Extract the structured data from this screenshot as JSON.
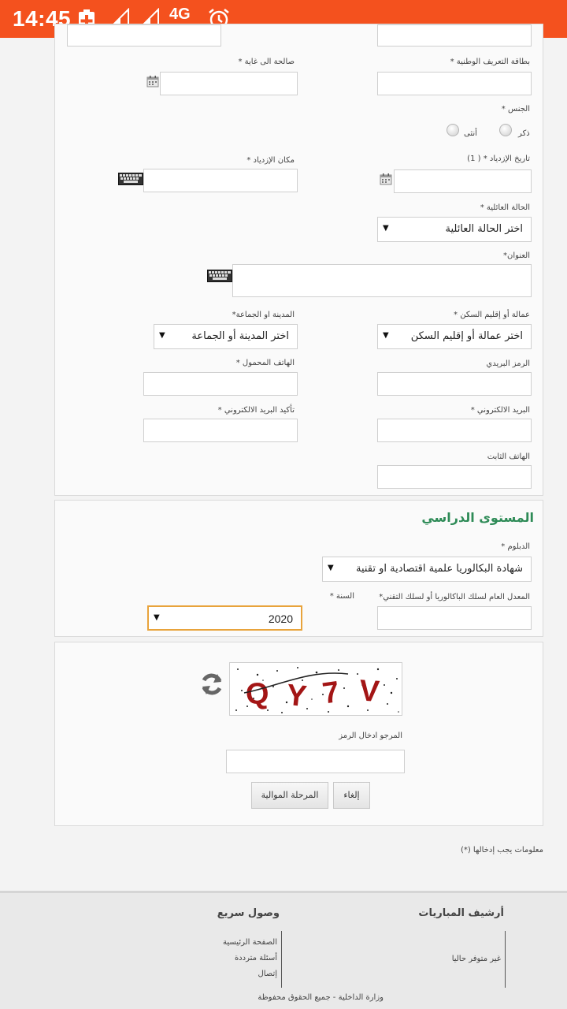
{
  "status_bar": {
    "time": "14:45",
    "network": "4G"
  },
  "personal": {
    "expiry_label": "صالحة الى غاية *",
    "cin_label": "بطاقة التعريف الوطنية *",
    "gender_label": "الجنس *",
    "gender_male": "ذكر",
    "gender_female": "أنثى",
    "birth_date_label": "تاريخ الإزدياد * ( 1)",
    "birth_place_label": "مكان الإزدياد *",
    "marital_label": "الحالة العائلية *",
    "marital_value": "اختر الحالة العائلية",
    "address_label": "العنوان*",
    "prefecture_label": "عمالة أو إقليم السكن *",
    "prefecture_value": "اختر عمالة أو إقليم السكن",
    "city_label": "المدينة او الجماعة*",
    "city_value": "اختر المدينة أو الجماعة",
    "postal_label": "الرمز البريدي",
    "mobile_label": "الهاتف المحمول *",
    "email_label": "البريد الالكتروني *",
    "email_confirm_label": "تأكيد البريد الالكتروني *",
    "landline_label": "الهاتف الثابت"
  },
  "education": {
    "title": "المستوى الدراسي",
    "diploma_label": "الدبلوم *",
    "diploma_value": "شهادة البكالوريا علمية اقتصادية او تقنية",
    "average_label": "المعدل العام لسلك الباكالوريا أو لسلك التقني*",
    "year_label": "السنة *",
    "year_value": "2020"
  },
  "captcha": {
    "text": "QY7V",
    "prompt_label": "المرجو ادخال الرمز",
    "cancel_label": "إلغاء",
    "next_label": "المرحلة الموالية"
  },
  "required_note": "معلومات يجب إدخالها (*)",
  "footer": {
    "archive_title": "أرشيف المباريات",
    "archive_text": "غير متوفر حاليا",
    "quick_title": "وصول سريع",
    "quick_links": [
      "الصفحة الرئيسية",
      "أسئلة مترددة",
      "إتصال"
    ],
    "copyright": "وزارة الداخلية - جميع الحقوق محفوظة"
  },
  "colors": {
    "status_bar": "#f4511e",
    "section_title": "#2e8b57",
    "focus_border": "#e8a33b"
  }
}
